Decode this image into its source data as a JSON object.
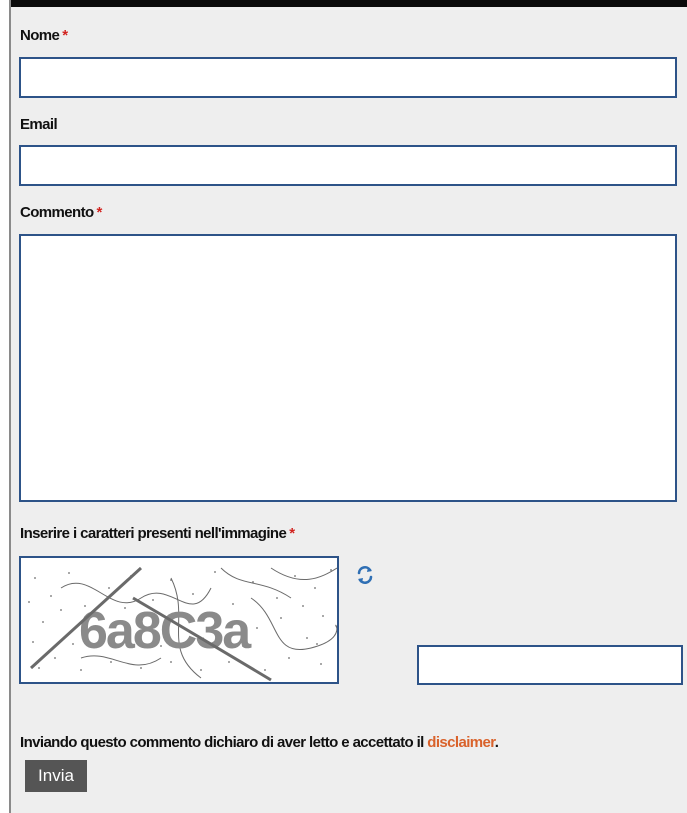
{
  "form": {
    "name_label": "Nome",
    "name_value": "",
    "email_label": "Email",
    "email_value": "",
    "comment_label": "Commento",
    "comment_value": "",
    "captcha_label": "Inserire i caratteri presenti nell'immagine",
    "captcha_text": "6a8C3a",
    "captcha_value": "",
    "required_marker": "*",
    "disclaimer_prefix": "Inviando questo commento dichiaro di aver letto e accettato il ",
    "disclaimer_link": "disclaimer",
    "disclaimer_suffix": ".",
    "submit_label": "Invia"
  },
  "icons": {
    "refresh": "refresh-icon"
  },
  "colors": {
    "field_border": "#2d5388",
    "required": "#d2231f",
    "link": "#d9622b",
    "button_bg": "#555555",
    "form_bg": "#eeeeee"
  }
}
